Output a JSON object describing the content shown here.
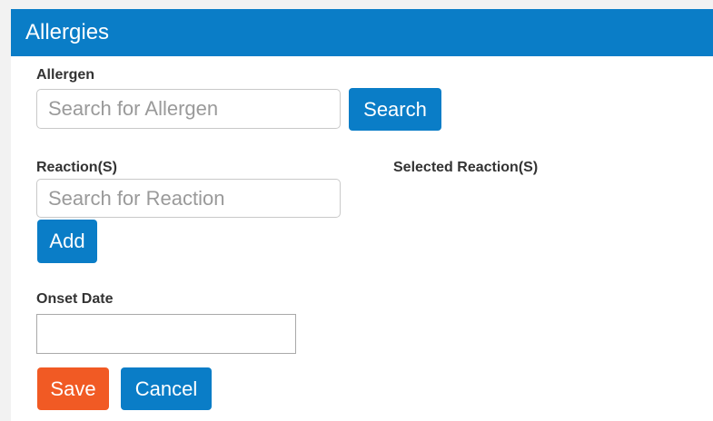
{
  "dialog": {
    "title": "Allergies"
  },
  "allergen": {
    "label": "Allergen",
    "placeholder": "Search for Allergen",
    "value": "",
    "search_label": "Search"
  },
  "reactions": {
    "label": "Reaction(S)",
    "placeholder": "Search for Reaction",
    "value": "",
    "add_label": "Add",
    "selected_label": "Selected Reaction(S)"
  },
  "onset": {
    "label": "Onset Date",
    "value": ""
  },
  "actions": {
    "save_label": "Save",
    "cancel_label": "Cancel"
  },
  "colors": {
    "primary": "#0a7dc7",
    "save": "#f15a24",
    "header_text": "#ffffff"
  }
}
